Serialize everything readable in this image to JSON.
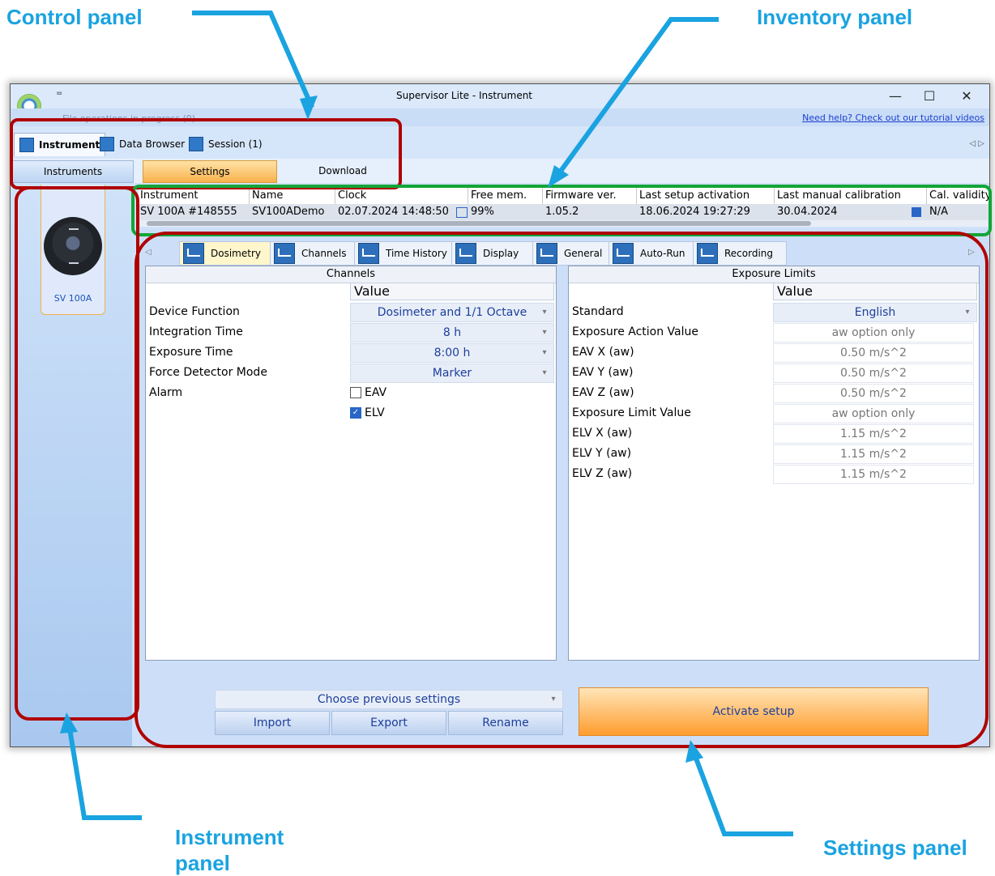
{
  "callouts": {
    "control": "Control panel",
    "inventory": "Inventory panel",
    "instrument": "Instrument panel",
    "settings": "Settings panel"
  },
  "window": {
    "title": "Supervisor Lite - Instrument",
    "qat_glyph": "=",
    "faded_text": "File operations in progress (0)",
    "help_link": "Need help? Check out our tutorial videos",
    "minimize": "—",
    "maximize": "☐",
    "close": "✕"
  },
  "main_tabs": [
    {
      "label": "Instrument"
    },
    {
      "label": "Data Browser"
    },
    {
      "label": "Session (1)"
    }
  ],
  "nav_arrows": "◁ ▷",
  "subtabs": {
    "instruments": "Instruments",
    "settings": "Settings",
    "download": "Download"
  },
  "instrument_panel": {
    "device_label": "SV 100A"
  },
  "inventory": {
    "headers": [
      "Instrument",
      "Name",
      "Clock",
      "Free mem.",
      "Firmware ver.",
      "Last setup activation",
      "Last manual calibration",
      "Cal. validity"
    ],
    "row": [
      "SV 100A #148555",
      "SV100ADemo",
      "02.07.2024 14:48:50",
      "99%",
      "1.05.2",
      "18.06.2024 19:27:29",
      "30.04.2024",
      "N/A"
    ]
  },
  "settings_tabs": [
    {
      "label": "Dosimetry"
    },
    {
      "label": "Channels"
    },
    {
      "label": "Time History"
    },
    {
      "label": "Display"
    },
    {
      "label": "General"
    },
    {
      "label": "Auto-Run"
    },
    {
      "label": "Recording"
    }
  ],
  "channels": {
    "title": "Channels",
    "value_header": "Value",
    "rows": [
      {
        "label": "Device Function",
        "value": "Dosimeter and 1/1 Octave"
      },
      {
        "label": "Integration Time",
        "value": "8 h"
      },
      {
        "label": "Exposure Time",
        "value": "8:00 h"
      },
      {
        "label": "Force Detector Mode",
        "value": "Marker"
      },
      {
        "label": "Alarm",
        "value": ""
      }
    ],
    "alarm_options": [
      {
        "label": "EAV",
        "checked": false
      },
      {
        "label": "ELV",
        "checked": true
      }
    ]
  },
  "exposure": {
    "title": "Exposure Limits",
    "value_header": "Value",
    "rows": [
      {
        "label": "Standard",
        "value": "English"
      },
      {
        "label": "Exposure Action Value",
        "value": "aw option only"
      },
      {
        "label": "EAV X (aw)",
        "value": "0.50 m/s^2"
      },
      {
        "label": "EAV Y (aw)",
        "value": "0.50 m/s^2"
      },
      {
        "label": "EAV Z (aw)",
        "value": "0.50 m/s^2"
      },
      {
        "label": "Exposure Limit Value",
        "value": "aw option only"
      },
      {
        "label": "ELV X (aw)",
        "value": "1.15 m/s^2"
      },
      {
        "label": "ELV Y (aw)",
        "value": "1.15 m/s^2"
      },
      {
        "label": "ELV Z (aw)",
        "value": "1.15 m/s^2"
      }
    ]
  },
  "bottom": {
    "choose": "Choose previous settings",
    "import": "Import",
    "export": "Export",
    "rename": "Rename",
    "activate": "Activate setup"
  },
  "colors": {
    "callout": "#1aa3e0",
    "highlight_red": "#b00000",
    "highlight_green": "#13a538",
    "accent_orange": "#ff9d2e"
  }
}
